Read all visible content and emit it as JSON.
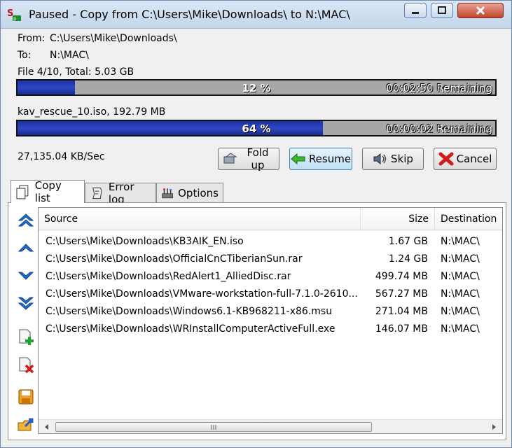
{
  "window": {
    "title": "Paused - Copy from C:\\Users\\Mike\\Downloads\\ to N:\\MAC\\"
  },
  "info": {
    "from_label": "From:",
    "from_value": "C:\\Users\\Mike\\Downloads\\",
    "to_label": "To:",
    "to_value": "N:\\MAC\\",
    "file_summary": "File 4/10, Total: 5.03 GB",
    "current_file": "kav_rescue_10.iso, 192.79 MB",
    "speed": "27,135.04 KB/Sec"
  },
  "progress": {
    "total": {
      "percent": 12,
      "label": "12 %",
      "remaining": "00:02:50 Remaining"
    },
    "file": {
      "percent": 64,
      "label": "64 %",
      "remaining": "00:00:02 Remaining"
    }
  },
  "buttons": {
    "fold_up": "Fold up",
    "resume": "Resume",
    "skip": "Skip",
    "cancel": "Cancel"
  },
  "tabs": [
    {
      "label": "Copy list",
      "icon": "copy-list-icon",
      "active": true
    },
    {
      "label": "Error log",
      "icon": "error-log-icon",
      "active": false
    },
    {
      "label": "Options",
      "icon": "tools-icon",
      "active": false
    }
  ],
  "list": {
    "columns": [
      "Source",
      "Size",
      "Destination"
    ],
    "rows": [
      {
        "source": "C:\\Users\\Mike\\Downloads\\KB3AIK_EN.iso",
        "size": "1.67 GB",
        "destination": "N:\\MAC\\"
      },
      {
        "source": "C:\\Users\\Mike\\Downloads\\OfficialCnCTiberianSun.rar",
        "size": "1.24 GB",
        "destination": "N:\\MAC\\"
      },
      {
        "source": "C:\\Users\\Mike\\Downloads\\RedAlert1_AlliedDisc.rar",
        "size": "499.74 MB",
        "destination": "N:\\MAC\\"
      },
      {
        "source": "C:\\Users\\Mike\\Downloads\\VMware-workstation-full-7.1.0-2610...",
        "size": "567.27 MB",
        "destination": "N:\\MAC\\"
      },
      {
        "source": "C:\\Users\\Mike\\Downloads\\Windows6.1-KB968211-x86.msu",
        "size": "271.04 MB",
        "destination": "N:\\MAC\\"
      },
      {
        "source": "C:\\Users\\Mike\\Downloads\\WRInstallComputerActiveFull.exe",
        "size": "146.07 MB",
        "destination": "N:\\MAC\\"
      }
    ]
  },
  "colors": {
    "progress_fill": "#1f35a8",
    "progress_track": "#a7a7a7"
  }
}
